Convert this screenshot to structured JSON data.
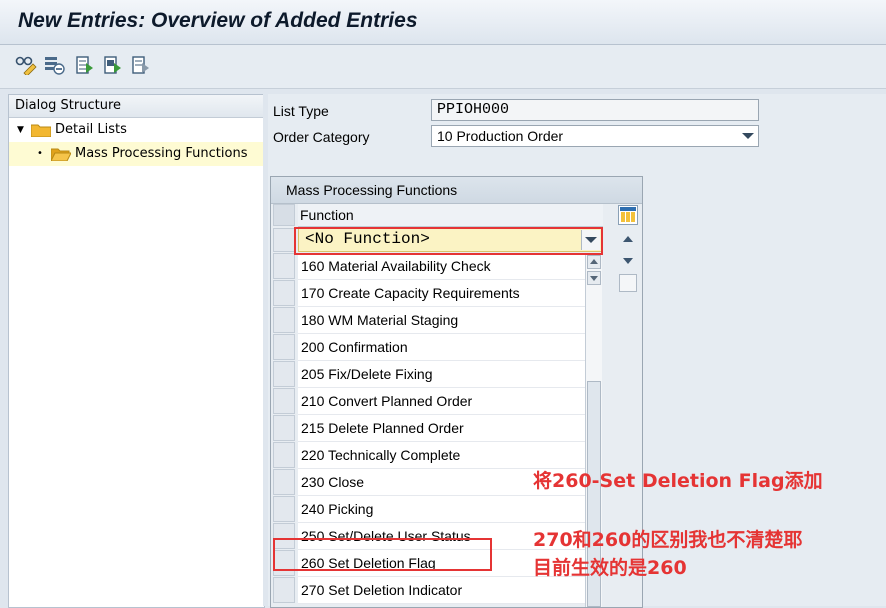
{
  "window": {
    "title": "New Entries: Overview of Added Entries"
  },
  "toolbar": {
    "icons": [
      "glasses-change-icon",
      "delete-rows-icon",
      "select-all-icon",
      "select-block-icon",
      "deselect-all-icon"
    ]
  },
  "dialog_structure": {
    "header": "Dialog Structure",
    "items": [
      {
        "label": "Detail Lists",
        "expanded": true,
        "selected": false
      },
      {
        "label": "Mass Processing Functions",
        "selected": true
      }
    ]
  },
  "form": {
    "list_type": {
      "label": "List Type",
      "value": "PPIOH000"
    },
    "order_category": {
      "label": "Order Category",
      "value": "10 Production Order"
    }
  },
  "table": {
    "title": "Mass Processing Functions",
    "column_header": "Function",
    "dropdown_value": "<No Function>",
    "rows": [
      "160 Material Availability Check",
      "170 Create Capacity Requirements",
      "180 WM Material Staging",
      "200 Confirmation",
      "205 Fix/Delete Fixing",
      "210 Convert Planned Order",
      "215 Delete Planned Order",
      "220 Technically Complete",
      "230 Close",
      "240 Picking",
      "250 Set/Delete User Status",
      "260 Set Deletion Flag",
      "270 Set Deletion Indicator"
    ]
  },
  "annotations": {
    "note1": "将260-Set Deletion Flag添加",
    "note2_line1": "270和260的区别我也不清楚耶",
    "note2_line2": "目前生效的是260"
  },
  "colors": {
    "annotation": "#e53434",
    "selected_row": "#fefbd3",
    "folder": "#f2b731"
  }
}
